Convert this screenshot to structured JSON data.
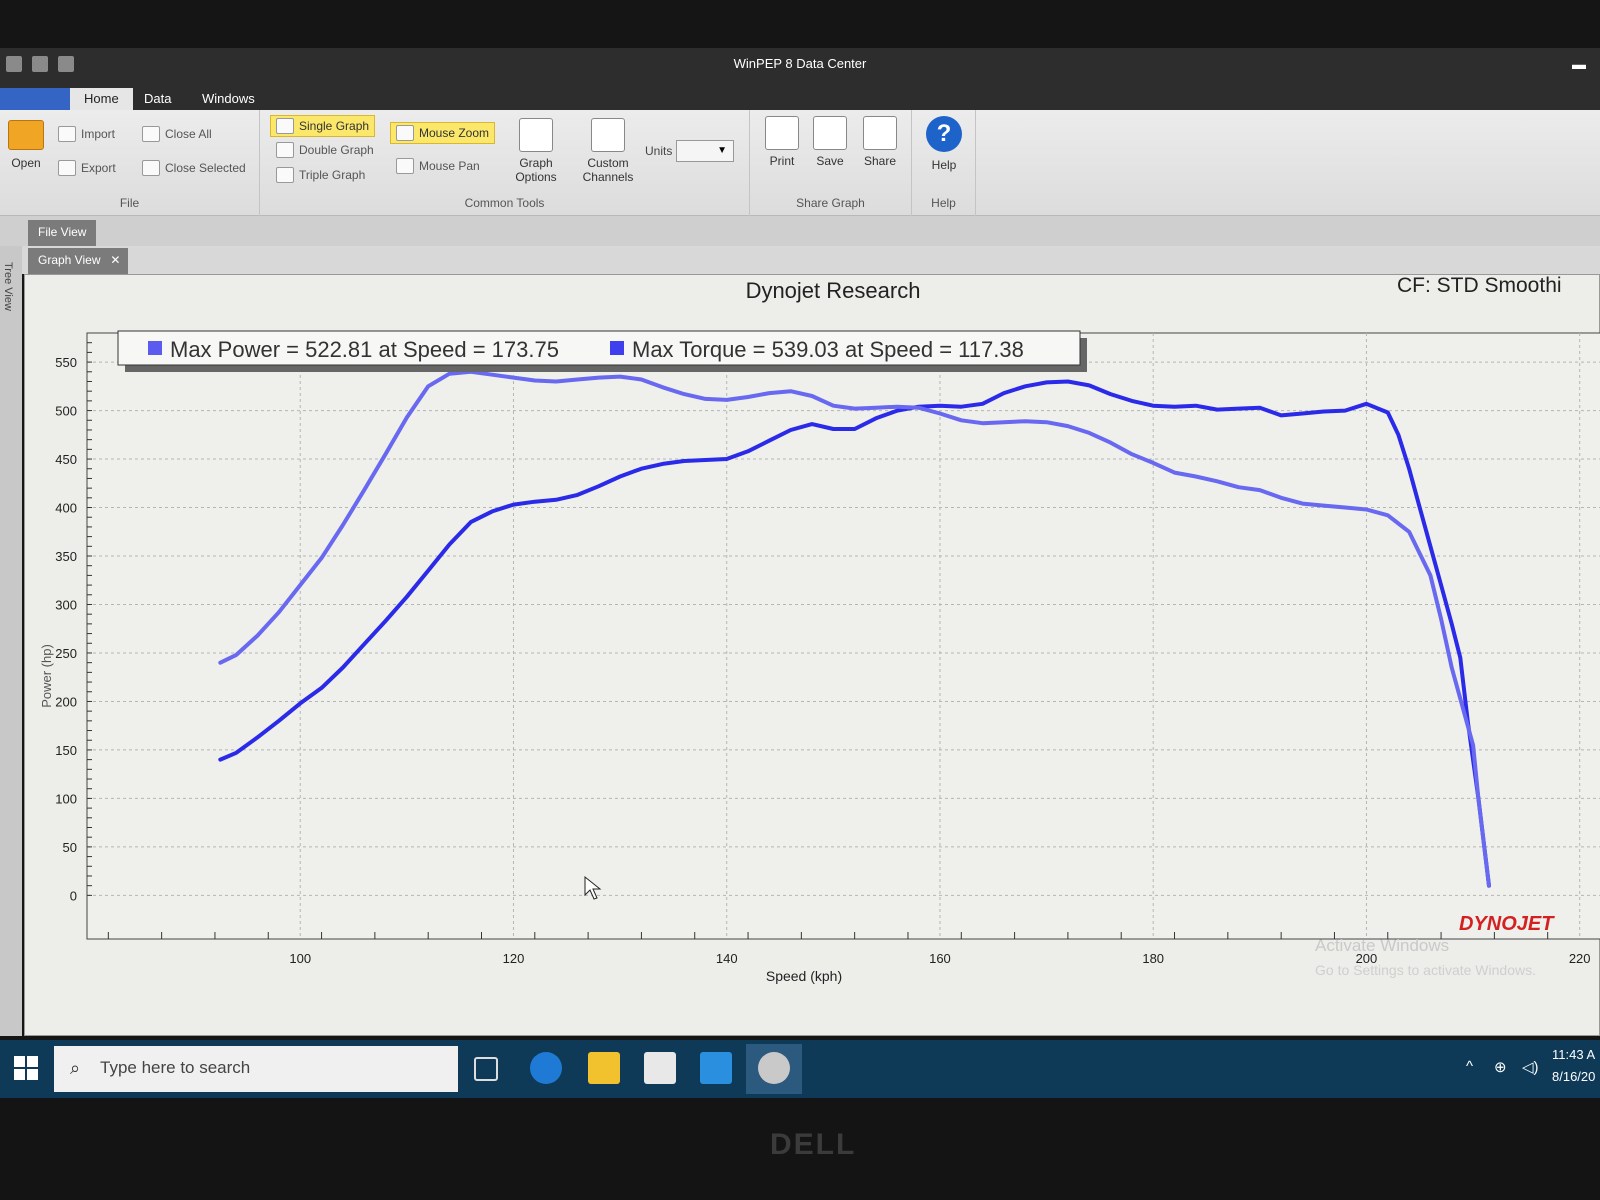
{
  "window": {
    "title": "WinPEP 8 Data Center"
  },
  "ribbon": {
    "tabs": [
      "Home",
      "Data",
      "Windows"
    ],
    "file_group": {
      "label": "File",
      "open": "Open",
      "import": "Import",
      "export": "Export",
      "close_all": "Close All",
      "close_selected": "Close Selected"
    },
    "common_tools": {
      "label": "Common Tools",
      "single_graph": "Single Graph",
      "double_graph": "Double Graph",
      "triple_graph": "Triple Graph",
      "mouse_zoom": "Mouse Zoom",
      "mouse_pan": "Mouse Pan",
      "graph_options": "Graph Options",
      "custom_channels": "Custom Channels",
      "units_label": "Units",
      "units_value": ""
    },
    "share_graph": {
      "label": "Share Graph",
      "print": "Print",
      "save": "Save",
      "share": "Share"
    },
    "help_group": {
      "label": "Help",
      "help": "Help"
    }
  },
  "doc_tabs": {
    "file_view": "File View",
    "graph_view": "Graph View",
    "tree_view": "Tree View"
  },
  "chart_data": {
    "type": "line",
    "title": "Dynojet Research",
    "header_right": "CF: STD Smoothi",
    "legend": [
      {
        "text": "Max Power = 522.81 at Speed = 173.75",
        "color": "#5b5bf0"
      },
      {
        "text": "Max Torque = 539.03 at Speed = 117.38",
        "color": "#3f3fee"
      }
    ],
    "xlabel": "Speed (kph)",
    "ylabel": "Power (hp)",
    "xlim": [
      80,
      222
    ],
    "ylim": [
      -45,
      580
    ],
    "xticks": [
      100,
      120,
      140,
      160,
      180,
      200,
      220
    ],
    "yticks": [
      0,
      50,
      100,
      150,
      200,
      250,
      300,
      350,
      400,
      450,
      500,
      550
    ],
    "grid": true,
    "watermark": "DYNOJET",
    "activate_notice": [
      "Activate Windows",
      "Go to Settings to activate Windows."
    ],
    "series": [
      {
        "color": "#2a2ae8",
        "points": [
          [
            92.5,
            140
          ],
          [
            94,
            147
          ],
          [
            96,
            163
          ],
          [
            98,
            180
          ],
          [
            100,
            198
          ],
          [
            102,
            214
          ],
          [
            104,
            235
          ],
          [
            106,
            259
          ],
          [
            108,
            283
          ],
          [
            110,
            308
          ],
          [
            112,
            335
          ],
          [
            114,
            362
          ],
          [
            116,
            385
          ],
          [
            118,
            396
          ],
          [
            120,
            403
          ],
          [
            122,
            406
          ],
          [
            124,
            408
          ],
          [
            126,
            413
          ],
          [
            128,
            422
          ],
          [
            130,
            432
          ],
          [
            132,
            440
          ],
          [
            134,
            445
          ],
          [
            136,
            448
          ],
          [
            138,
            449
          ],
          [
            140,
            450
          ],
          [
            142,
            458
          ],
          [
            144,
            469
          ],
          [
            146,
            480
          ],
          [
            148,
            486
          ],
          [
            150,
            481
          ],
          [
            152,
            481
          ],
          [
            154,
            492
          ],
          [
            156,
            500
          ],
          [
            158,
            504
          ],
          [
            160,
            505
          ],
          [
            162,
            504
          ],
          [
            164,
            507
          ],
          [
            166,
            518
          ],
          [
            168,
            525
          ],
          [
            170,
            529
          ],
          [
            172,
            530
          ],
          [
            174,
            526
          ],
          [
            176,
            517
          ],
          [
            178,
            510
          ],
          [
            180,
            505
          ],
          [
            182,
            504
          ],
          [
            184,
            505
          ],
          [
            186,
            501
          ],
          [
            188,
            502
          ],
          [
            190,
            503
          ],
          [
            192,
            495
          ],
          [
            194,
            497
          ],
          [
            196,
            499
          ],
          [
            198,
            500
          ],
          [
            200,
            507
          ],
          [
            202,
            498
          ],
          [
            203,
            475
          ],
          [
            204,
            440
          ],
          [
            205,
            400
          ],
          [
            206,
            360
          ],
          [
            207,
            320
          ],
          [
            208,
            280
          ],
          [
            208.8,
            245
          ],
          [
            209.5,
            180
          ],
          [
            210.5,
            100
          ],
          [
            211.5,
            10
          ]
        ]
      },
      {
        "color": "#6868f0",
        "points": [
          [
            92.5,
            240
          ],
          [
            94,
            248
          ],
          [
            96,
            268
          ],
          [
            98,
            292
          ],
          [
            100,
            320
          ],
          [
            102,
            348
          ],
          [
            104,
            382
          ],
          [
            106,
            418
          ],
          [
            108,
            455
          ],
          [
            110,
            493
          ],
          [
            112,
            525
          ],
          [
            114,
            538
          ],
          [
            116,
            540
          ],
          [
            118,
            537
          ],
          [
            120,
            534
          ],
          [
            122,
            531
          ],
          [
            124,
            530
          ],
          [
            126,
            532
          ],
          [
            128,
            534
          ],
          [
            130,
            535
          ],
          [
            132,
            532
          ],
          [
            134,
            524
          ],
          [
            136,
            517
          ],
          [
            138,
            512
          ],
          [
            140,
            511
          ],
          [
            142,
            514
          ],
          [
            144,
            518
          ],
          [
            146,
            520
          ],
          [
            148,
            515
          ],
          [
            150,
            505
          ],
          [
            152,
            502
          ],
          [
            154,
            503
          ],
          [
            156,
            504
          ],
          [
            158,
            503
          ],
          [
            160,
            497
          ],
          [
            162,
            490
          ],
          [
            164,
            487
          ],
          [
            166,
            488
          ],
          [
            168,
            489
          ],
          [
            170,
            488
          ],
          [
            172,
            484
          ],
          [
            174,
            477
          ],
          [
            176,
            467
          ],
          [
            178,
            455
          ],
          [
            180,
            446
          ],
          [
            182,
            436
          ],
          [
            184,
            432
          ],
          [
            186,
            427
          ],
          [
            188,
            421
          ],
          [
            190,
            418
          ],
          [
            192,
            410
          ],
          [
            194,
            404
          ],
          [
            196,
            402
          ],
          [
            198,
            400
          ],
          [
            200,
            398
          ],
          [
            202,
            392
          ],
          [
            204,
            375
          ],
          [
            206,
            330
          ],
          [
            207,
            285
          ],
          [
            208,
            235
          ],
          [
            209,
            195
          ],
          [
            210,
            155
          ],
          [
            210.5,
            100
          ],
          [
            211.5,
            10
          ]
        ]
      }
    ]
  },
  "taskbar": {
    "search_placeholder": "Type here to search",
    "icons": [
      "task-view-icon",
      "edge-icon",
      "file-explorer-icon",
      "store-icon",
      "mail-icon",
      "winpep-icon"
    ],
    "clock_time": "11:43 A",
    "clock_date": "8/16/20"
  },
  "bezel": {
    "brand": "DELL"
  }
}
